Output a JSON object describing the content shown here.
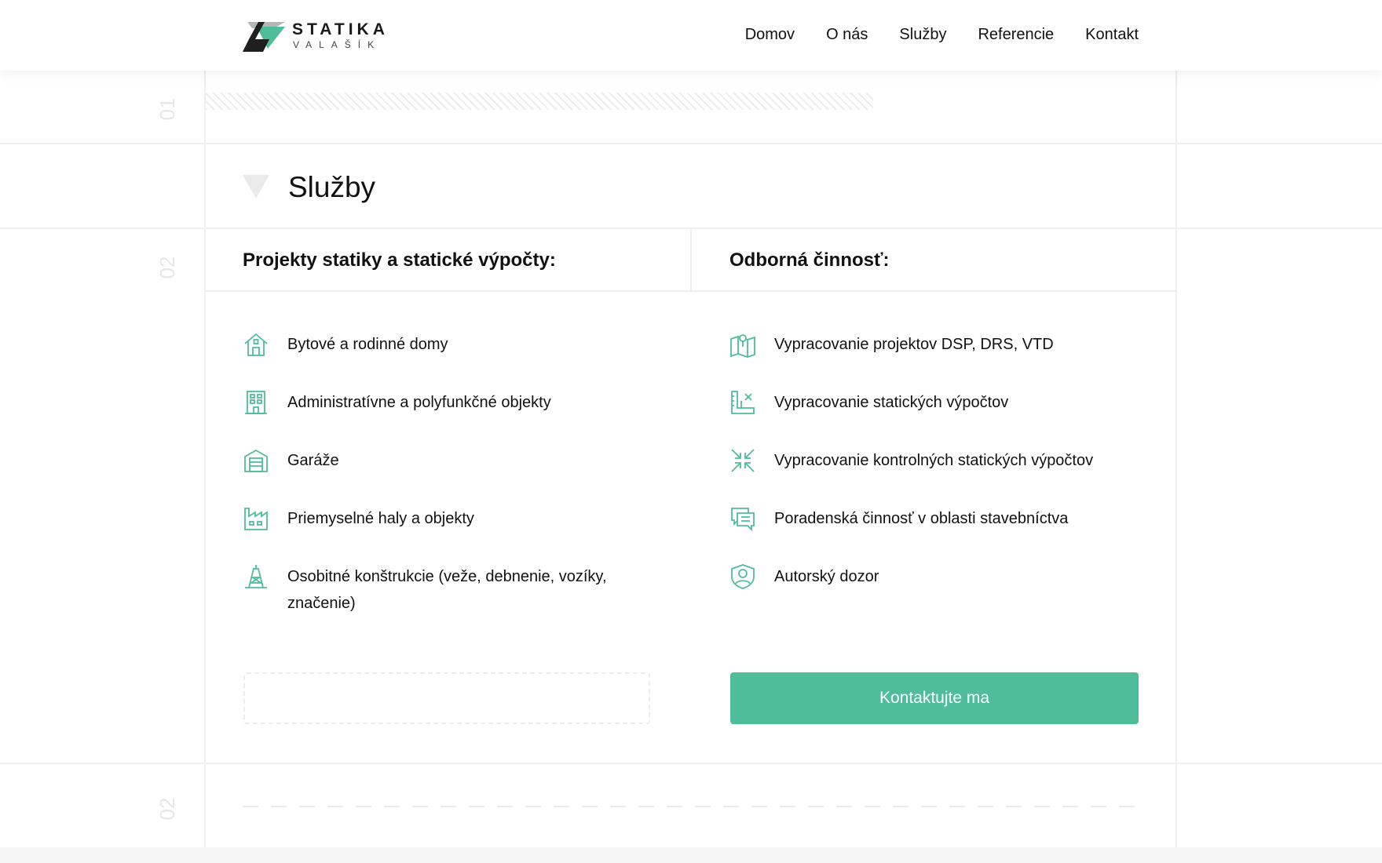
{
  "brand": {
    "name": "STATIKA",
    "sub": "VALAŠÍK"
  },
  "nav": [
    "Domov",
    "O nás",
    "Služby",
    "Referencie",
    "Kontakt"
  ],
  "side_numbers": [
    "01",
    "02",
    "02"
  ],
  "section": {
    "title": "Služby"
  },
  "columns": [
    {
      "heading": "Projekty statiky a statické výpočty:",
      "items": [
        {
          "icon": "house-icon",
          "label": "Bytové a rodinné domy"
        },
        {
          "icon": "office-building-icon",
          "label": "Administratívne a polyfunkčné objekty"
        },
        {
          "icon": "garage-icon",
          "label": "Garáže"
        },
        {
          "icon": "factory-icon",
          "label": "Priemyselné haly a objekty"
        },
        {
          "icon": "tower-icon",
          "label": "Osobitné konštrukcie (veže, debnenie, vozíky, značenie)"
        }
      ]
    },
    {
      "heading": "Odborná činnosť:",
      "items": [
        {
          "icon": "map-pin-icon",
          "label": "Vypracovanie projektov DSP, DRS, VTD"
        },
        {
          "icon": "blueprint-icon",
          "label": "Vypracovanie statických výpočtov"
        },
        {
          "icon": "compress-arrows-icon",
          "label": "Vypracovanie kontrolných statických výpočtov"
        },
        {
          "icon": "chat-bubbles-icon",
          "label": "Poradenská činnosť v oblasti stavebníctva"
        },
        {
          "icon": "user-shield-icon",
          "label": "Autorský dozor"
        }
      ]
    }
  ],
  "cta": {
    "label": "Kontaktujte ma"
  },
  "colors": {
    "accent": "#4fbd9a",
    "logo_dark": "#1f1f1f",
    "logo_grey": "#b5b5b5",
    "grid": "#eeeeee"
  }
}
